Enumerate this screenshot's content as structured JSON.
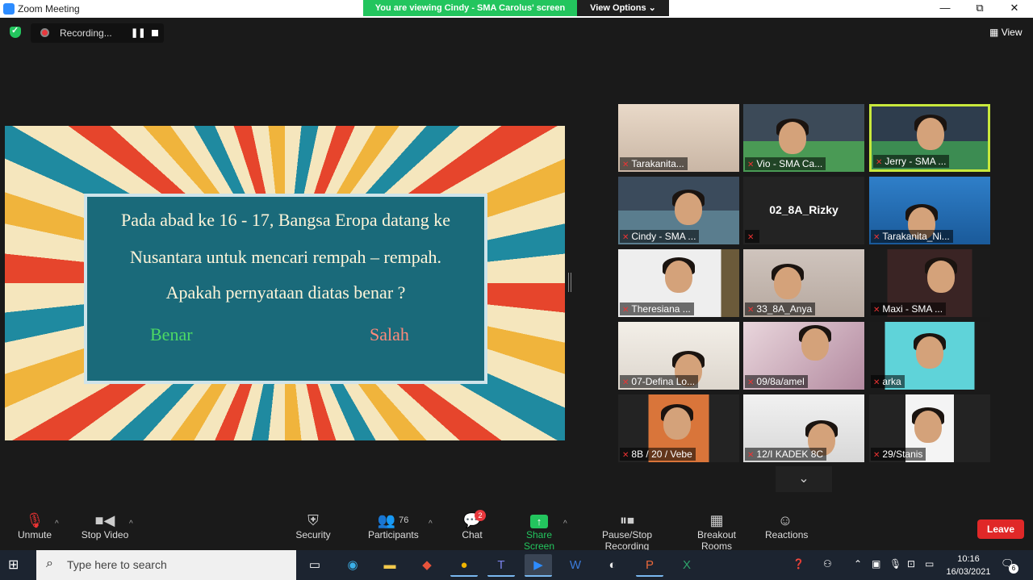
{
  "window": {
    "title": "Zoom Meeting",
    "minimize": "—",
    "restore": "⧉",
    "close": "✕"
  },
  "share": {
    "banner": "You are viewing Cindy - SMA Carolus' screen",
    "view_options": "View Options"
  },
  "recording": {
    "label": "Recording...",
    "pause_icon": "pause-icon",
    "stop_icon": "stop-icon"
  },
  "view_label": "View",
  "slide": {
    "line1": "Pada abad ke 16 - 17, Bangsa Eropa datang ke",
    "line2": "Nusantara untuk mencari rempah – rempah.",
    "line3": "Apakah pernyataan diatas benar ?",
    "answer_true": "Benar",
    "answer_false": "Salah",
    "answer_true_color": "#4cd964",
    "answer_false_color": "#ff8a7a"
  },
  "participants": [
    {
      "name": "Tarakanita...",
      "muted": true
    },
    {
      "name": "Vio - SMA Ca...",
      "muted": true
    },
    {
      "name": "Jerry - SMA ...",
      "muted": true,
      "active_speaker": true
    },
    {
      "name": "Cindy - SMA ...",
      "muted": true
    },
    {
      "name": "02_8A_Rizky",
      "muted": true,
      "video_off": true
    },
    {
      "name": "Tarakanita_Ni...",
      "muted": true
    },
    {
      "name": "Theresiana ...",
      "muted": true
    },
    {
      "name": "33_8A_Anya",
      "muted": true
    },
    {
      "name": "Maxi - SMA ...",
      "muted": true
    },
    {
      "name": "07-Defina Lo...",
      "muted": true
    },
    {
      "name": "09/8a/amel",
      "muted": true
    },
    {
      "name": "arka",
      "muted": true
    },
    {
      "name": "8B / 20 / Vebe",
      "muted": true
    },
    {
      "name": "12/I KADEK 8C",
      "muted": true
    },
    {
      "name": "29/Stanis",
      "muted": true
    }
  ],
  "toolbar": {
    "unmute": "Unmute",
    "stop_video": "Stop Video",
    "security": "Security",
    "participants": "Participants",
    "participants_count": "76",
    "chat": "Chat",
    "chat_badge": "2",
    "share_screen": "Share Screen",
    "pause_stop_recording": "Pause/Stop Recording",
    "breakout_rooms": "Breakout Rooms",
    "reactions": "Reactions",
    "leave": "Leave"
  },
  "taskbar": {
    "search_placeholder": "Type here to search",
    "time": "10:16",
    "date": "16/03/2021",
    "notification_count": "6"
  },
  "colors": {
    "accent_green": "#23c55e",
    "leave_red": "#e02828",
    "active_speaker_border": "#c8e83c"
  }
}
